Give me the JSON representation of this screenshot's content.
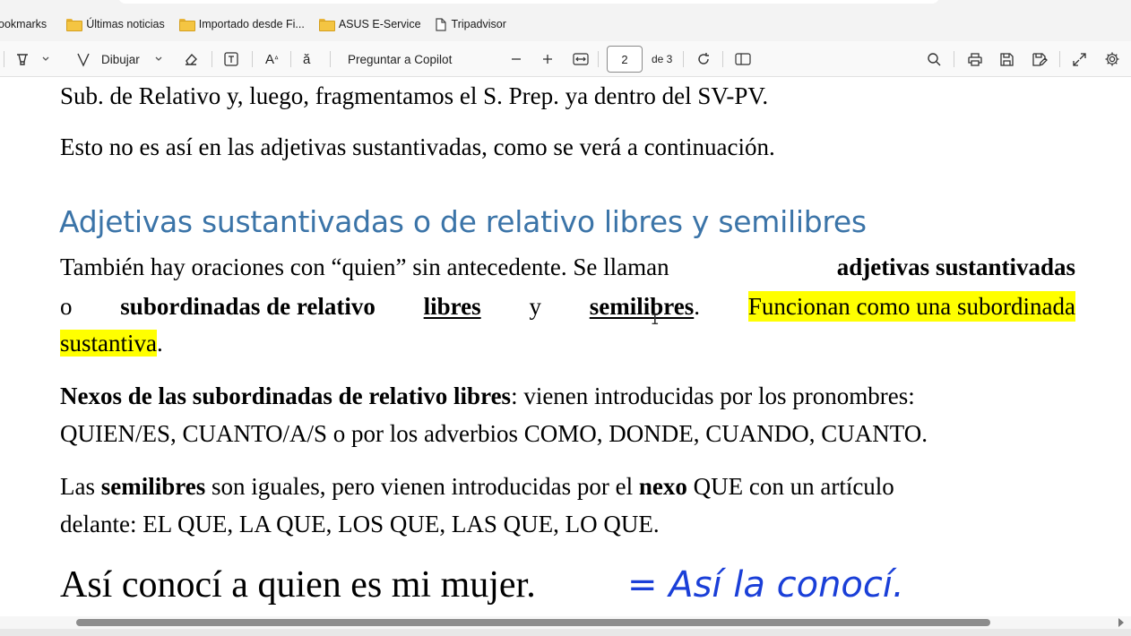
{
  "bookmarks": [
    {
      "label": "ookmarks",
      "icon": "none"
    },
    {
      "label": "Últimas noticias",
      "icon": "folder-icon"
    },
    {
      "label": "Importado desde Fi...",
      "icon": "folder-icon"
    },
    {
      "label": "ASUS E-Service",
      "icon": "folder-icon"
    },
    {
      "label": "Tripadvisor",
      "icon": "page-icon"
    }
  ],
  "toolbar": {
    "draw_label": "Dibujar",
    "copilot_label": "Preguntar a Copilot",
    "page_current": "2",
    "page_total": "de 3",
    "text_icon_glyph": "A",
    "read_icon_glyph": "ă"
  },
  "document": {
    "p1": "Sub. de Relativo y, luego, fragmentamos el S. Prep. ya dentro del SV-PV.",
    "p2": "Esto no es así en las adjetivas sustantivadas, como se verá a continuación.",
    "heading": "Adjetivas sustantivadas o de relativo libres y semilibres",
    "p3": {
      "l1_a": "También hay oraciones con “quien” sin antecedente. Se llaman ",
      "l1_b": "adjetivas sustantivadas",
      "l2_a": "o",
      "l2_b": "subordinadas de relativo",
      "l2_c": "libres",
      "l2_d": "y",
      "l2_e": "semilibres",
      "l2_f": ".",
      "l2_g": "Funcionan como una subordinada",
      "l3_a": "sustantiva",
      "l3_b": "."
    },
    "p4": {
      "l1_a": "Nexos de las subordinadas de relativo libres",
      "l1_b": ": vienen introducidas por los pronombres:",
      "l2": "QUIEN/ES, CUANTO/A/S o por los adverbios COMO, DONDE, CUANDO, CUANTO."
    },
    "p5": {
      "l1_a": "Las ",
      "l1_b": "semilibres",
      "l1_c": " son iguales, pero vienen introducidas por el ",
      "l1_d": "nexo",
      "l1_e": " QUE con un artículo",
      "l2": "delante: EL QUE, LA QUE, LOS QUE, LAS QUE, LO QUE."
    },
    "example": "Así conocí a quien es mi mujer.",
    "handwriting": "= Así la conocí."
  },
  "colors": {
    "heading": "#3b74a8",
    "highlight": "#ffff00",
    "ink": "#1a3fd8"
  }
}
